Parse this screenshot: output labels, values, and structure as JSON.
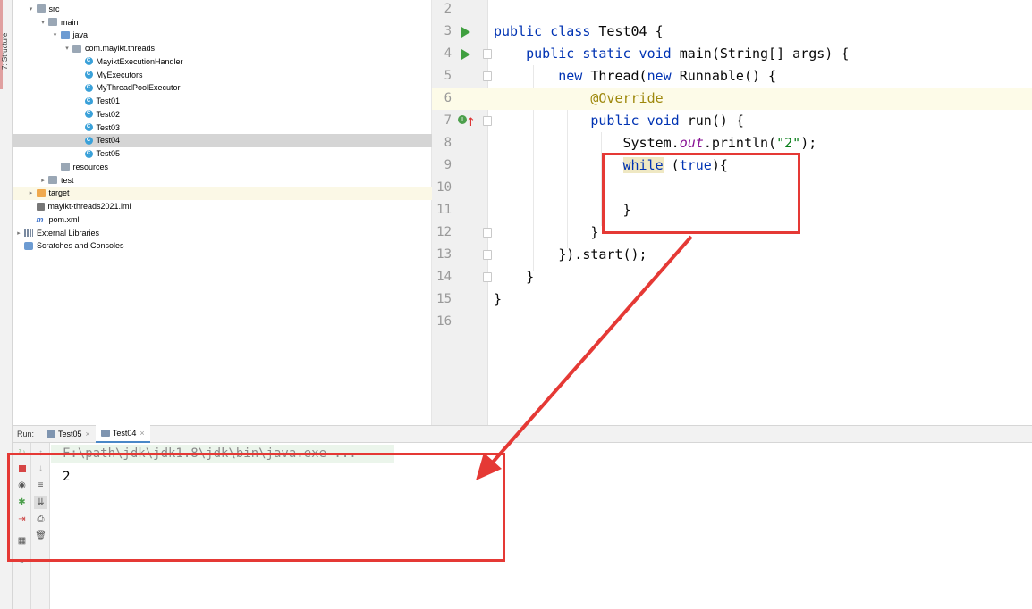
{
  "sidebar_tab": "7: Structure",
  "project_tree": [
    {
      "label": "src",
      "indent": 1,
      "icon": "folder-icon",
      "arrow": "▾"
    },
    {
      "label": "main",
      "indent": 2,
      "icon": "folder-icon",
      "arrow": "▾"
    },
    {
      "label": "java",
      "indent": 3,
      "icon": "source-folder-icon",
      "arrow": "▾"
    },
    {
      "label": "com.mayikt.threads",
      "indent": 4,
      "icon": "package-icon",
      "arrow": "▾"
    },
    {
      "label": "MayiktExecutionHandler",
      "indent": 5,
      "icon": "class-icon",
      "arrow": ""
    },
    {
      "label": "MyExecutors",
      "indent": 5,
      "icon": "class-icon",
      "arrow": ""
    },
    {
      "label": "MyThreadPoolExecutor",
      "indent": 5,
      "icon": "class-icon",
      "arrow": ""
    },
    {
      "label": "Test01",
      "indent": 5,
      "icon": "class-icon",
      "arrow": ""
    },
    {
      "label": "Test02",
      "indent": 5,
      "icon": "class-icon",
      "arrow": ""
    },
    {
      "label": "Test03",
      "indent": 5,
      "icon": "class-icon",
      "arrow": ""
    },
    {
      "label": "Test04",
      "indent": 5,
      "icon": "class-icon",
      "arrow": "",
      "selected": true
    },
    {
      "label": "Test05",
      "indent": 5,
      "icon": "class-icon",
      "arrow": ""
    },
    {
      "label": "resources",
      "indent": 3,
      "icon": "resources-folder-icon",
      "arrow": ""
    },
    {
      "label": "test",
      "indent": 2,
      "icon": "folder-icon",
      "arrow": "▸"
    },
    {
      "label": "target",
      "indent": 1,
      "icon": "excluded-folder-icon",
      "arrow": "▸",
      "highlight": true
    },
    {
      "label": "mayikt-threads2021.iml",
      "indent": 1,
      "icon": "iml-file-icon",
      "arrow": ""
    },
    {
      "label": "pom.xml",
      "indent": 1,
      "icon": "maven-icon",
      "arrow": ""
    },
    {
      "label": "External Libraries",
      "indent": 0,
      "icon": "library-icon",
      "arrow": "▸"
    },
    {
      "label": "Scratches and Consoles",
      "indent": 0,
      "icon": "scratches-icon",
      "arrow": ""
    }
  ],
  "editor": {
    "current_line": 6,
    "lines": [
      {
        "num": "2",
        "html": ""
      },
      {
        "num": "3",
        "run": true,
        "html": "<span class=\"kw\">public class</span> Test04 {"
      },
      {
        "num": "4",
        "run": true,
        "fold": true,
        "html": "    <span class=\"kw\">public static void</span> main(String[] args) {"
      },
      {
        "num": "5",
        "fold": true,
        "html": "        <span class=\"kw\">new</span> Thread(<span class=\"kw\">new</span> Runnable() {"
      },
      {
        "num": "6",
        "html": "            <span class=\"ann\">@Override</span>"
      },
      {
        "num": "7",
        "override": true,
        "fold": true,
        "html": "            <span class=\"kw\">public void</span> run() {"
      },
      {
        "num": "8",
        "html": "                System.<span class=\"fld\">out</span>.println(<span class=\"str\">\"2\"</span>);"
      },
      {
        "num": "9",
        "html": "                <span class=\"kw while-hl\">while</span> (<span class=\"kw\">true</span>){"
      },
      {
        "num": "10",
        "html": ""
      },
      {
        "num": "11",
        "html": "                }"
      },
      {
        "num": "12",
        "fold": true,
        "html": "            }"
      },
      {
        "num": "13",
        "fold": true,
        "html": "        }).start();"
      },
      {
        "num": "14",
        "fold": true,
        "html": "    }"
      },
      {
        "num": "15",
        "html": "}"
      },
      {
        "num": "16",
        "html": ""
      }
    ]
  },
  "run_panel": {
    "label": "Run:",
    "tabs": [
      {
        "label": "Test05",
        "close": "×",
        "active": false
      },
      {
        "label": "Test04",
        "close": "×",
        "active": true
      }
    ],
    "command": "F:\\path\\jdk\\jdk1.8\\jdk\\bin\\java.exe ...",
    "output": "2"
  },
  "colors": {
    "annotation": "#e53935",
    "selection": "#d5d5d5",
    "run_green": "#3f9f3f"
  }
}
